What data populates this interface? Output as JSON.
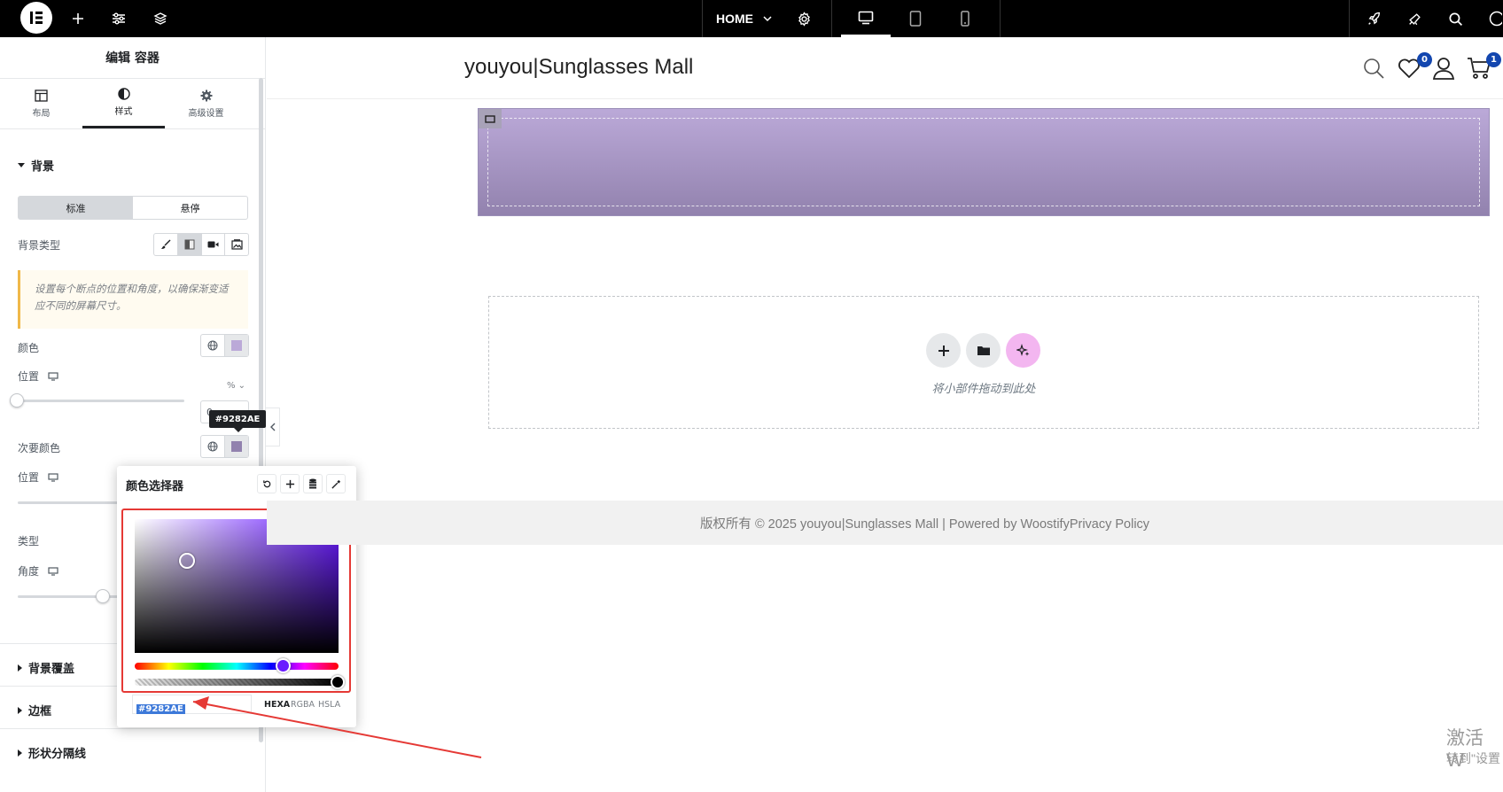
{
  "topbar": {
    "page_label": "HOME",
    "icons": [
      "plus-icon",
      "sliders-icon",
      "layers-icon",
      "settings-icon",
      "desktop-icon",
      "tablet-icon",
      "mobile-icon",
      "rocket-icon",
      "megaphone-icon",
      "search-icon",
      "help-icon"
    ]
  },
  "panel": {
    "title": "编辑 容器",
    "tabs": [
      {
        "label": "布局",
        "icon": "layout-icon"
      },
      {
        "label": "样式",
        "icon": "contrast-icon"
      },
      {
        "label": "高级设置",
        "icon": "gear-icon"
      }
    ],
    "background_section": "背景",
    "state_normal": "标准",
    "state_hover": "悬停",
    "bg_type_label": "背景类型",
    "notice": "设置每个断点的位置和角度，以确保渐变适应不同的屏幕尺寸。",
    "color_label": "颜色",
    "position_label": "位置",
    "unit": "% ⌄",
    "location_value": "0",
    "tooltip": "#9282AE",
    "secondary_color_label": "次要颜色",
    "position_label_2": "位置",
    "type_label": "类型",
    "angle_label": "角度",
    "overlay_section": "背景覆盖",
    "border_section": "边框",
    "shape_divider_section": "形状分隔线"
  },
  "picker": {
    "title": "颜色选择器",
    "hex_value": "#9282AE",
    "formats": [
      "HEXA",
      "RGBA",
      "HSLA"
    ],
    "active_format": "HEXA"
  },
  "canvas": {
    "site_title": "youyou|Sunglasses Mall",
    "wishlist_count": "0",
    "cart_count": "1",
    "drop_text": "将小部件拖动到此处",
    "footer_text": "版权所有 © 2025 youyou|Sunglasses Mall | Powered by WoostifyPrivacy Policy"
  },
  "watermark": {
    "line1": "激活 W",
    "line2": "转到\"设置"
  },
  "colors": {
    "primary_color": "#BBA9D8",
    "secondary_color": "#9282AE",
    "badge": "#1346AF",
    "annotation_red": "#E53935"
  }
}
